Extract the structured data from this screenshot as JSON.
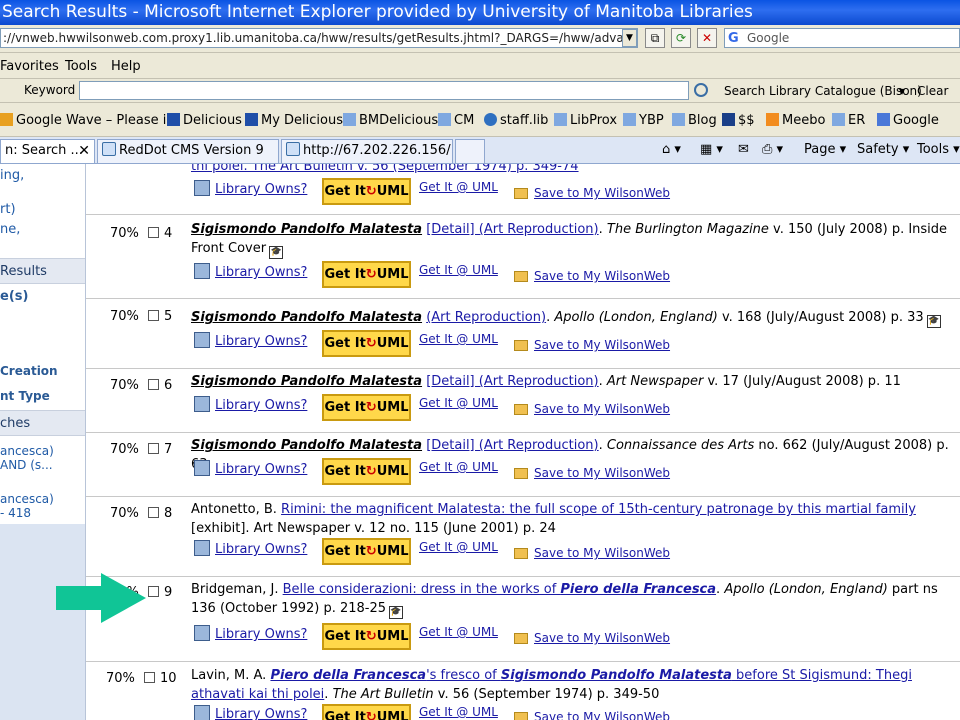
{
  "window": {
    "title": "Search Results - Microsoft Internet Explorer provided by University of Manitoba Libraries"
  },
  "address": {
    "url": "://vnweb.hwwilsonweb.com.proxy1.lib.umanitoba.ca/hww/results/getResults.jhtml?_DARGS=/hww/advanced",
    "search_placeholder": "Google"
  },
  "menu": {
    "items": [
      "Favorites",
      "Tools",
      "Help"
    ]
  },
  "keyword_bar": {
    "label": "Keyword",
    "search_catalogue": "Search Library Catalogue (Bison)",
    "clear": "Clear"
  },
  "links": {
    "items": [
      "Google Wave – Please i...",
      "Delicious",
      "My Delicious",
      "BMDelicious",
      "CM",
      "staff.lib",
      "LibProx",
      "YBP",
      "Blog",
      "$$",
      "Meebo",
      "ER",
      "Google"
    ]
  },
  "tabs": {
    "items": [
      "n: Search ...",
      "RedDot CMS Version 9",
      "http://67.202.226.156/..."
    ],
    "commands": [
      "Page",
      "Safety",
      "Tools"
    ]
  },
  "sidebar": {
    "items": [
      "ing,",
      "rt)",
      "ne,",
      "Results",
      "e(s)",
      "Creation",
      "nt Type",
      "ches",
      "ancesca)",
      "AND (s...",
      "ancesca)",
      "- 418"
    ]
  },
  "results": {
    "action_labels": {
      "library_owns": "Library Owns?",
      "get_it_prefix": "Get It",
      "get_it_suffix": "UML",
      "get_it_at": "Get It @ UML",
      "save": "Save to My WilsonWeb"
    },
    "partial_top": {
      "line": "thi polei. The Art Bulletin v. 56 (September 1974) p. 349-74"
    },
    "items": [
      {
        "pct": "70%",
        "num": "4",
        "title": "Sigismondo Pandolfo Malatesta",
        "links": "[Detail] (Art Reproduction)",
        "rest_journal": "The Burlington Magazine",
        "rest_tail": " v. 150 (July 2008) p. Inside Front Cover"
      },
      {
        "pct": "70%",
        "num": "5",
        "title": "Sigismondo Pandolfo Malatesta",
        "links": "(Art Reproduction)",
        "rest_journal": "Apollo (London, England)",
        "rest_tail": " v. 168 (July/August 2008) p. 33"
      },
      {
        "pct": "70%",
        "num": "6",
        "title": "Sigismondo Pandolfo Malatesta",
        "links": "[Detail] (Art Reproduction)",
        "rest_journal": "Art Newspaper",
        "rest_tail": " v. 17 (July/August 2008) p. 11"
      },
      {
        "pct": "70%",
        "num": "7",
        "title": "Sigismondo Pandolfo Malatesta",
        "links": "[Detail] (Art Reproduction)",
        "rest_journal": "Connaissance des Arts",
        "rest_tail": " no. 662 (July/August 2008) p. 63"
      },
      {
        "pct": "70%",
        "num": "8",
        "author": "Antonetto, B.",
        "title_link": "Rimini: the magnificent Malatesta: the full scope of 15th-century patronage by this martial family",
        "mid": " [exhibit]. Art Newspaper",
        "rest_tail": " v. 12 no. 115 (June 2001) p. 24"
      },
      {
        "pct": "70%",
        "num": "9",
        "author": "Bridgeman, J.",
        "title_link_a": "Belle considerazioni: dress in the works of ",
        "title_link_b": "Piero della Francesca",
        "rest_journal": "Apollo (London, England)",
        "rest_tail": " part ns 136 (October 1992) p. 218-25"
      },
      {
        "pct": "70%",
        "num": "10",
        "author": "Lavin, M. A.",
        "title_b1": "Piero della Francesca",
        "title_a1": "'s fresco of ",
        "title_b2": "Sigismondo Pandolfo Malatesta",
        "title_a2": " before St Sigismund: Thegi athavati kai thi polei",
        "rest_journal": "The Art Bulletin",
        "rest_tail": " v. 56 (September 1974) p. 349-50"
      }
    ]
  },
  "colors": {
    "titlebar": "#0a54e3",
    "chrome": "#ece9d8",
    "link": "#1a1aa6",
    "get_it": "#ffd84a",
    "arrow": "#10c596"
  }
}
